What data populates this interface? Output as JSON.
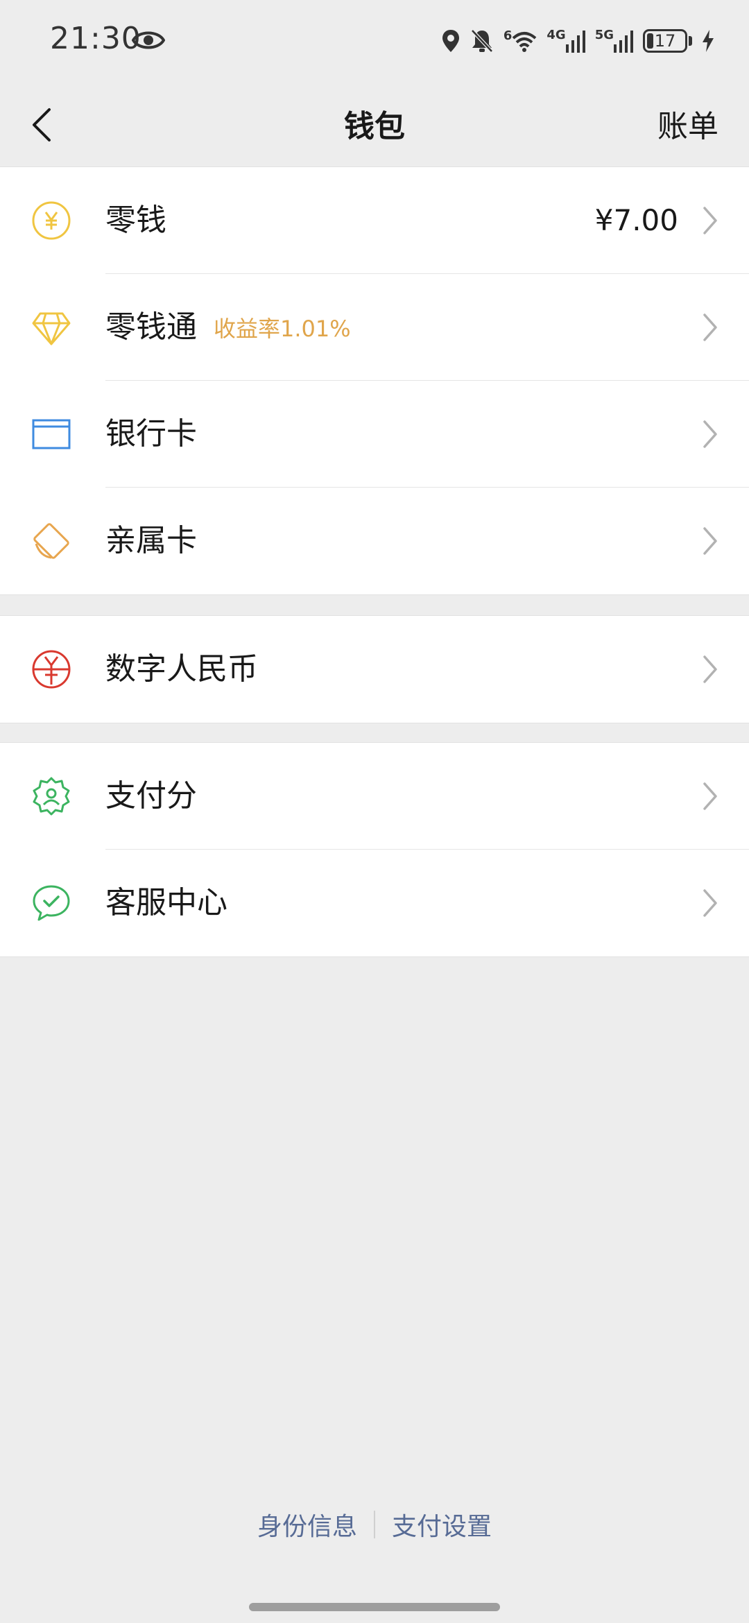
{
  "status_bar": {
    "time": "21:30",
    "wifi_label": "6",
    "net1_label": "4G",
    "net2_label": "5G",
    "battery": "17",
    "battery_level": 17
  },
  "header": {
    "title": "钱包",
    "right_action": "账单"
  },
  "groups": [
    {
      "items": [
        {
          "label": "零钱",
          "value": "¥7.00",
          "icon": "yuan-coin-icon",
          "color": "#f0c541"
        },
        {
          "label": "零钱通",
          "sublabel": "收益率1.01%",
          "icon": "diamond-icon",
          "color": "#f0c541"
        },
        {
          "label": "银行卡",
          "icon": "card-icon",
          "color": "#3f8be0"
        },
        {
          "label": "亲属卡",
          "icon": "family-card-icon",
          "color": "#e8a64f"
        }
      ]
    },
    {
      "items": [
        {
          "label": "数字人民币",
          "icon": "digital-rmb-icon",
          "color": "#d9392f"
        }
      ]
    },
    {
      "items": [
        {
          "label": "支付分",
          "icon": "pay-score-icon",
          "color": "#3cb460"
        },
        {
          "label": "客服中心",
          "icon": "customer-service-icon",
          "color": "#3cb460"
        }
      ]
    }
  ],
  "footer": {
    "identity_link": "身份信息",
    "settings_link": "支付设置"
  },
  "colors": {
    "background": "#ededed",
    "link": "#576b95",
    "accent_orange": "#e0a54b"
  }
}
